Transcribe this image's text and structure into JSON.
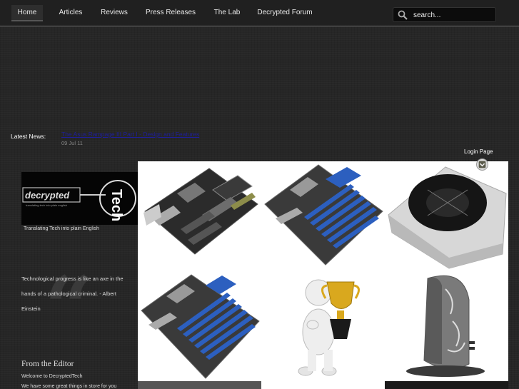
{
  "nav": {
    "items": [
      {
        "label": "Home",
        "active": true
      },
      {
        "label": "Articles",
        "active": false
      },
      {
        "label": "Reviews",
        "active": false
      },
      {
        "label": "Press Releases",
        "active": false
      },
      {
        "label": "The Lab",
        "active": false
      },
      {
        "label": "Decrypted Forum",
        "active": false
      }
    ]
  },
  "search": {
    "placeholder": "search..."
  },
  "news": {
    "label": "Latest News:",
    "headline": "The Asus Rampage III Part I - Design and Features",
    "date": "09 Jul 11"
  },
  "login": {
    "label": "Login Page"
  },
  "logo": {
    "text": "decrypted Tech",
    "tagline": "Translating Tech into plain English"
  },
  "quote": {
    "text": "Technological progress is like an axe in the hands of a pathological criminal. - Albert Einstein"
  },
  "editor": {
    "heading": "From the Editor",
    "line1": "Welcome to DecryptedTech",
    "line2": "We have some great things in store for you"
  },
  "gallery": {
    "tiles": [
      {
        "name": "motherboard-black",
        "icon": "motherboard"
      },
      {
        "name": "motherboard-blue-1",
        "icon": "motherboard"
      },
      {
        "name": "laptop-cooler",
        "icon": "cooling-pad"
      },
      {
        "name": "motherboard-blue-2",
        "icon": "motherboard"
      },
      {
        "name": "trophy-figure",
        "icon": "trophy"
      },
      {
        "name": "mini-pc",
        "icon": "pc-case"
      }
    ]
  },
  "colors": {
    "background": "#262626",
    "nav_bg": "#202020",
    "link": "#1e1e9a",
    "pcb_black": "#2b2b2b",
    "pcb_blue": "#2c5fbf",
    "trophy_gold": "#d9a81e"
  }
}
